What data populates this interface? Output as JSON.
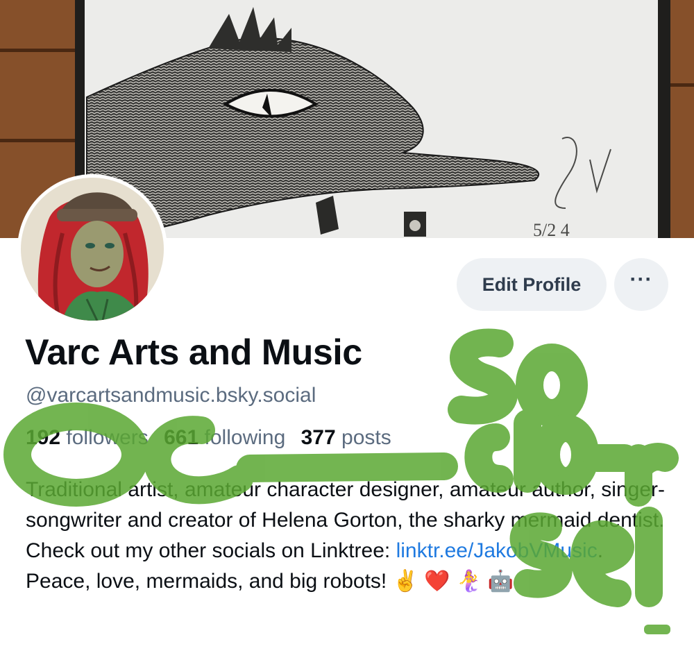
{
  "profile": {
    "display_name": "Varc Arts and Music",
    "handle": "@varcartsandmusic.bsky.social",
    "stats": {
      "followers_count": "192",
      "followers_label": "followers",
      "following_count": "661",
      "following_label": "following",
      "posts_count": "377",
      "posts_label": "posts"
    },
    "bio": {
      "text_before_link": "Traditional artist, amateur character designer, amateur author, singer-songwriter and creator of Helena Gorton, the sharky mermaid dentist. Check out my other socials on Linktree: ",
      "link_text": "linktr.ee/JakobVMusic",
      "text_after_link": ". Peace, love, mermaids, and big robots! ",
      "emoji": "✌️ ❤️ 🧜‍♀️ 🤖"
    }
  },
  "actions": {
    "edit_label": "Edit Profile",
    "more_label": "···"
  },
  "banner": {
    "signature_date": "5/2 4"
  },
  "overlay": {
    "scrawl_text": "OC so cio se!"
  },
  "colors": {
    "accent_link": "#1f7ae0",
    "muted_text": "#5b6b7f",
    "button_bg": "#eef1f4",
    "scrawl_green": "#5aa832"
  }
}
